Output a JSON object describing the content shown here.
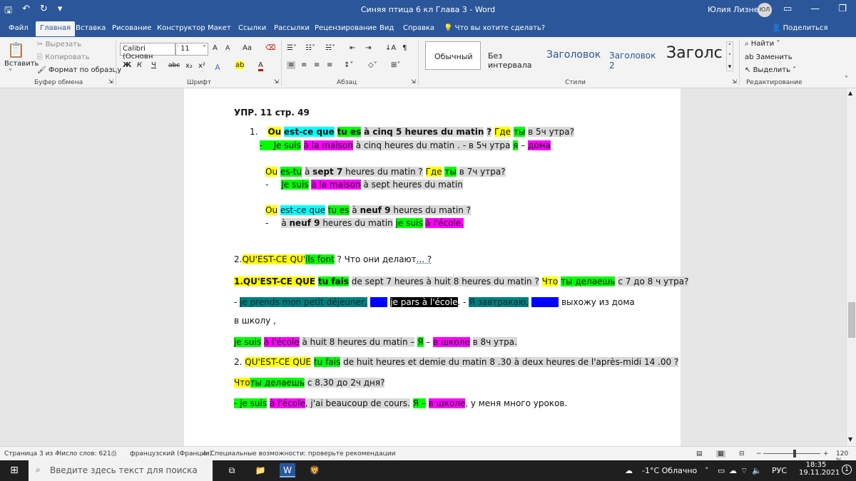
{
  "title_bar": {
    "title": "Синяя птица 6 кл Глава 3  -  Word",
    "user_name": "Юлия Лизнева",
    "user_initials": "ЮЛ"
  },
  "tabs": [
    "Файл",
    "Главная",
    "Вставка",
    "Рисование",
    "Конструктор",
    "Макет",
    "Ссылки",
    "Рассылки",
    "Рецензирование",
    "Вид",
    "Справка"
  ],
  "active_tab": "Главная",
  "tell_me": "Что вы хотите сделать?",
  "share": "Поделиться",
  "ribbon": {
    "clipboard": {
      "paste": "Вставить",
      "cut": "Вырезать",
      "copy": "Копировать",
      "format_painter": "Формат по образцу",
      "label": "Буфер обмена"
    },
    "font": {
      "font_name": "Calibri (Основн",
      "font_size": "11",
      "label": "Шрифт",
      "bold": "Ж",
      "italic": "К",
      "underline": "Ч",
      "strike": "abc",
      "grow": "A",
      "shrink": "A",
      "case": "Aa"
    },
    "paragraph": {
      "label": "Абзац"
    },
    "styles": {
      "items": [
        "Обычный",
        "Без интервала",
        "Заголовок",
        "Заголовок 2",
        "Заголс"
      ],
      "label": "Стили"
    },
    "editing": {
      "find": "Найти",
      "replace": "Заменить",
      "select": "Выделить",
      "label": "Редактирование"
    }
  },
  "document": {
    "title": "УПР. 11 стр. 49",
    "l1": {
      "num": "1.",
      "a": "Ou",
      "b": "est-ce que",
      "c": "tu es",
      "d": "à cinq 5 heures du matin",
      "e": "?",
      "f": "Где",
      "g": "ты",
      "h": "в 5ч утра?"
    },
    "l2": {
      "a": "-",
      "b": "Je suis",
      "c": "à la maison",
      "d": "à cinq heures du matin . - в 5ч утра",
      "e": "я",
      "f": "–",
      "g": "дома"
    },
    "l3": {
      "a": "Ou",
      "b": "es-tu",
      "c": "à ",
      "c2": "sept 7",
      "d": " heures du matin ?",
      "e": "Где",
      "f": "ты",
      "g": "в 7ч утра?"
    },
    "l4": {
      "a": "-",
      "b": "Je suis",
      "c": "à la maison",
      "d": "à sept heures du matin"
    },
    "l5": {
      "a": "Ou",
      "b": "est-ce que",
      "c": "tu es",
      "d": "à ",
      "d2": "neuf 9",
      "d3": " heures du matin ?"
    },
    "l6": {
      "a": "-",
      "b": "à ",
      "b2": "neuf 9",
      "b3": " heures du matin",
      "c": "je suis",
      "d": "à l'école."
    },
    "l7": {
      "a": "2.",
      "b": "QU'EST-CE QU'",
      "c": "ils font",
      "d": " ? Что они делают",
      "e": "... ?"
    },
    "l8": {
      "a": "1.QU'EST-CE QUE",
      "b": "tu fais",
      "c": "de sept 7 heures à huit 8 heures du matin ?",
      "d": "Что",
      "e": "ты делаешь",
      "f": "с 7 до 8 ч утра?"
    },
    "l9": {
      "a": "- ",
      "b": "je prends mon petit déjeuner,",
      "c": "puis",
      "d": "je pars à l'école",
      "e": ". - ",
      "f": "Я завтракаю,",
      "g": "потом",
      "h": " выхожу из дома"
    },
    "l10": "в школу ,",
    "l11": {
      "a": "je suis",
      "b": "à l'école",
      "c": "à huit 8 heures du matin –",
      "d": "Я",
      "e": "–",
      "f": "в школе",
      "g": "в 8ч утра."
    },
    "l12": {
      "a": "2. ",
      "b": "QU'EST-CE QUE",
      "c": "tu fais",
      "d": "de huit heures et demie du matin 8 .30 à deux heures de l'après-midi 14 .00 ?"
    },
    "l13": {
      "a": "Что",
      "b": "ты делаешь",
      "c": "с 8.30 до 2ч дня?"
    },
    "l14": {
      "a": "- je suis",
      "b": "à l'école",
      "c": ", j'ai beaucoup de cours.",
      "d": "Я –",
      "e": "в школе",
      "f": ", у меня много уроков."
    }
  },
  "status_bar": {
    "page": "Страница 3 из 4",
    "words": "Число слов: 621",
    "language": "французский (Франция)",
    "accessibility": "Специальные возможности: проверьте рекомендации",
    "zoom": "120 %"
  },
  "taskbar": {
    "search_placeholder": "Введите здесь текст для поиска",
    "weather": "-1°C  Облачно",
    "lang": "РУС",
    "time": "18:35",
    "date": "19.11.2021"
  }
}
